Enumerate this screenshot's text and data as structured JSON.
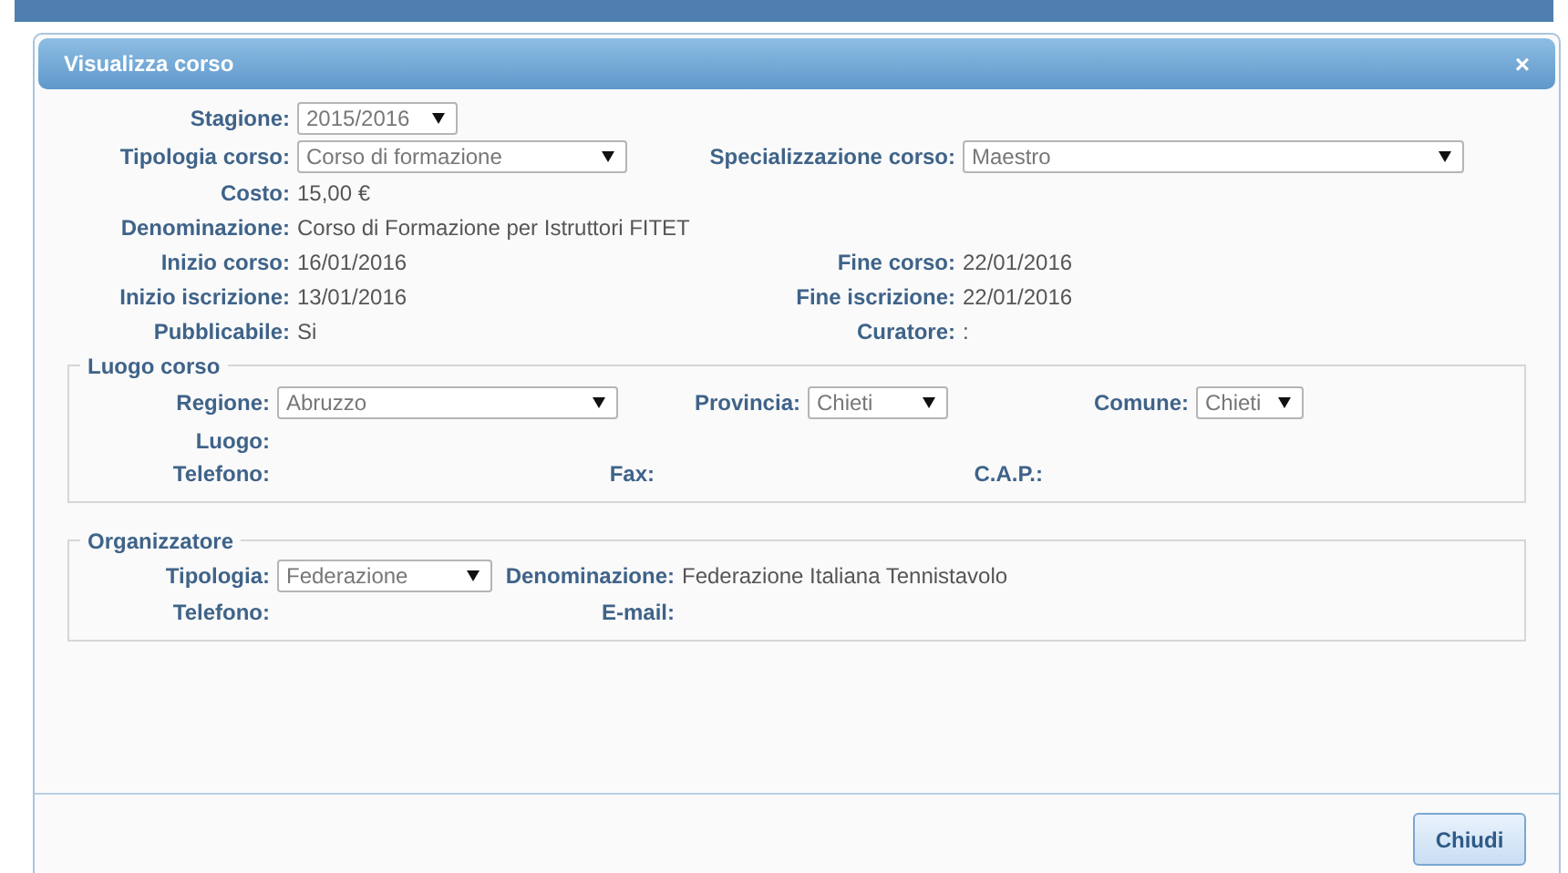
{
  "dialog": {
    "title": "Visualizza corso",
    "close": "×"
  },
  "main": [
    [
      {
        "label": "Stagione:",
        "kind": "select",
        "value": "2015/2016"
      }
    ],
    [
      {
        "label": "Tipologia corso:",
        "kind": "select",
        "value": "Corso di formazione"
      },
      {
        "label": "Specializzazione corso:",
        "kind": "select",
        "value": "Maestro"
      }
    ],
    [
      {
        "label": "Costo:",
        "kind": "text",
        "value": "15,00 €"
      }
    ],
    [
      {
        "label": "Denominazione:",
        "kind": "text",
        "value": "Corso di Formazione per Istruttori FITET"
      }
    ],
    [
      {
        "label": "Inizio corso:",
        "kind": "text",
        "value": "16/01/2016"
      },
      {
        "label": "Fine corso:",
        "kind": "text",
        "value": "22/01/2016"
      }
    ],
    [
      {
        "label": "Inizio iscrizione:",
        "kind": "text",
        "value": "13/01/2016"
      },
      {
        "label": "Fine iscrizione:",
        "kind": "text",
        "value": "22/01/2016"
      }
    ],
    [
      {
        "label": "Pubblicabile:",
        "kind": "text",
        "value": "Si"
      },
      {
        "label": "Curatore:",
        "kind": "text",
        "value": ":"
      }
    ]
  ],
  "luogo": {
    "legend": "Luogo corso",
    "rows": [
      [
        {
          "label": "Regione:",
          "kind": "select",
          "value": "Abruzzo"
        },
        {
          "label": "Provincia:",
          "kind": "select",
          "value": "Chieti"
        },
        {
          "label": "Comune:",
          "kind": "select",
          "value": "Chieti"
        }
      ],
      [
        {
          "label": "Luogo:",
          "kind": "text"
        }
      ],
      [
        {
          "label": "Telefono:",
          "kind": "text"
        },
        {
          "label": "Fax:",
          "kind": "text"
        },
        {
          "label": "C.A.P.:",
          "kind": "text"
        }
      ]
    ]
  },
  "organizzatore": {
    "legend": "Organizzatore",
    "rows": [
      [
        {
          "label": "Tipologia:",
          "kind": "select",
          "value": "Federazione"
        },
        {
          "label": "Denominazione:",
          "kind": "text",
          "value": "Federazione Italiana Tennistavolo"
        }
      ],
      [
        {
          "label": "Telefono:",
          "kind": "text"
        },
        {
          "label": "E-mail:",
          "kind": "text"
        }
      ]
    ]
  },
  "buttons": [
    "Chiudi"
  ]
}
